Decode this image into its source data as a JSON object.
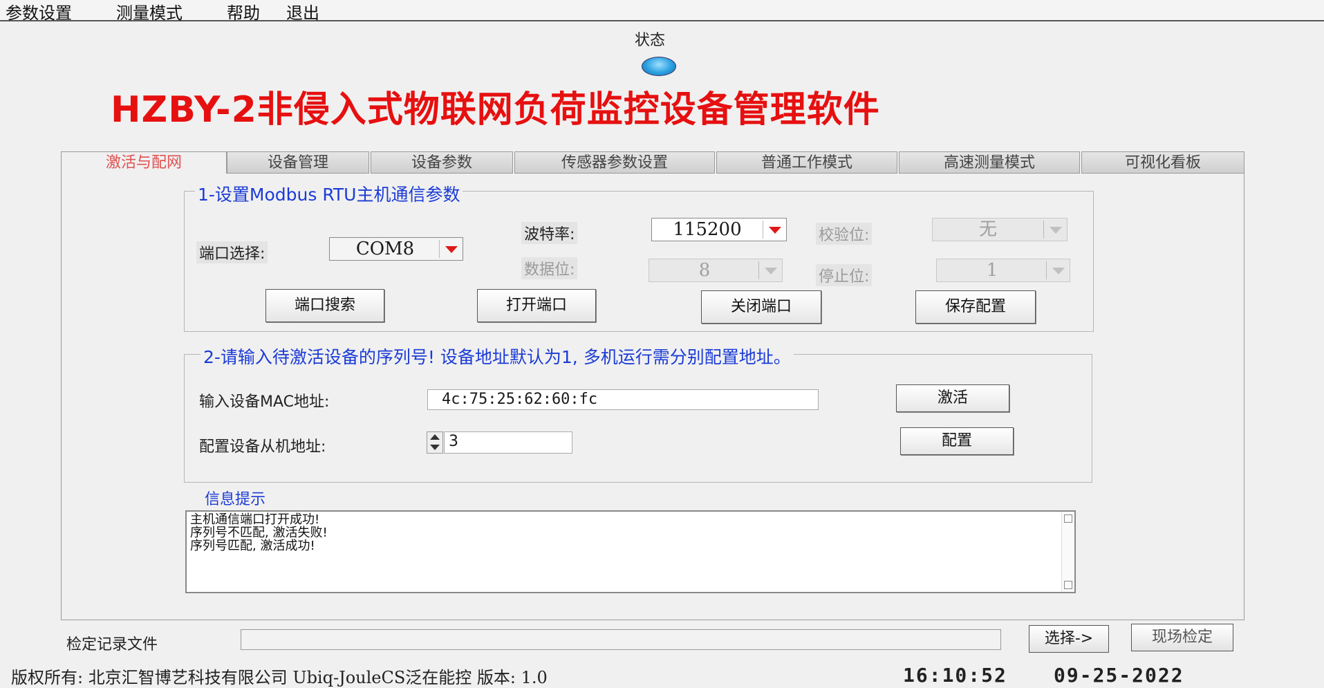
{
  "menu": [
    "参数设置",
    "测量模式",
    "帮助",
    "退出"
  ],
  "status": {
    "label": "状态"
  },
  "app_title": "HZBY-2非侵入式物联网负荷监控设备管理软件",
  "tabs": [
    "激活与配网",
    "设备管理",
    "设备参数",
    "传感器参数设置",
    "普通工作模式",
    "高速测量模式",
    "可视化看板"
  ],
  "active_tab": "激活与配网",
  "group1": {
    "title": "1-设置Modbus RTU主机通信参数",
    "port_label": "端口选择:",
    "port_value": "COM8",
    "baud_label": "波特率:",
    "baud_value": "115200",
    "parity_label": "校验位:",
    "parity_value": "无",
    "databits_label": "数据位:",
    "databits_value": "8",
    "stopbits_label": "停止位:",
    "stopbits_value": "1",
    "buttons": {
      "search": "端口搜索",
      "open": "打开端口",
      "close": "关闭端口",
      "save": "保存配置"
    }
  },
  "group2": {
    "title": "2-请输入待激活设备的序列号! 设备地址默认为1, 多机运行需分别配置地址。",
    "mac_label": "输入设备MAC地址:",
    "mac_value": "4c:75:25:62:60:fc",
    "activate_button": "激活",
    "slave_label": "配置设备从机地址:",
    "slave_value": "3",
    "config_button": "配置"
  },
  "info": {
    "title": "信息提示",
    "messages": [
      "主机通信端口打开成功!",
      "序列号不匹配, 激活失败!",
      "序列号匹配, 激活成功!"
    ]
  },
  "record": {
    "label": "检定记录文件",
    "path": "",
    "select_button": "选择->",
    "field_check_button": "现场检定"
  },
  "footer": {
    "copyright": "版权所有: 北京汇智博艺科技有限公司 Ubiq-JouleCS泛在能控 版本: 1.0",
    "time": "16:10:52",
    "date": "09-25-2022"
  },
  "colors": {
    "title_red": "#e61010",
    "group_title_blue": "#1b3bd6",
    "active_tab_text": "#e05050",
    "status_lamp": "#2a9fe0"
  }
}
